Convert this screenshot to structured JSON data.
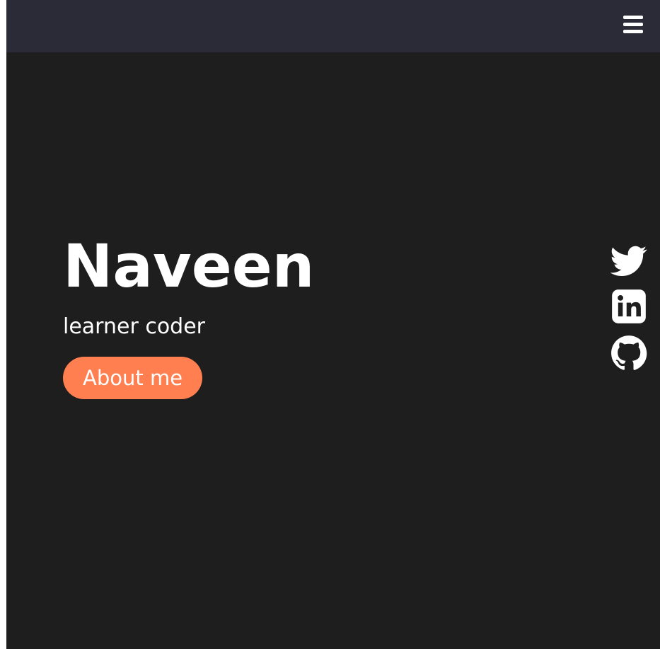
{
  "header": {
    "menu_icon": "hamburger-menu-icon"
  },
  "hero": {
    "title": "Naveen",
    "subtitle": "learner coder",
    "about_button_label": "About me"
  },
  "social": {
    "links": [
      {
        "icon": "twitter-icon"
      },
      {
        "icon": "linkedin-icon"
      },
      {
        "icon": "github-icon"
      }
    ]
  },
  "colors": {
    "background": "#1e1e1e",
    "header_background": "#2b2b38",
    "accent": "#ff7f50",
    "text": "#ffffff"
  }
}
